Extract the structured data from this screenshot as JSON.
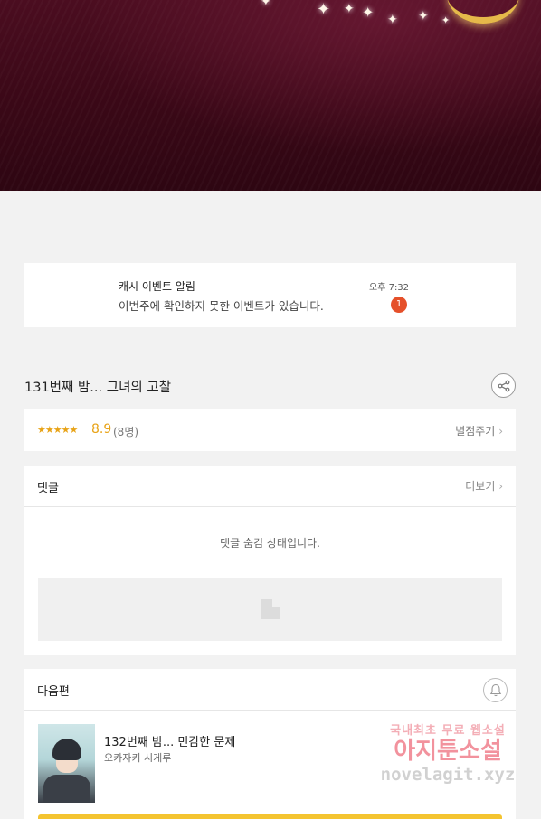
{
  "notification": {
    "title": "캐시 이벤트 알림",
    "message": "이번주에 확인하지 못한 이벤트가 있습니다.",
    "time": "오후 7:32",
    "badge_count": "1"
  },
  "episode": {
    "title": "131번째 밤... 그녀의 고찰",
    "share_icon": "share-icon"
  },
  "rating": {
    "stars": "★★★★★",
    "score": "8.9",
    "count": "(8명)",
    "rate_link": "별점주기",
    "accent_color": "#e8a317"
  },
  "comments": {
    "header": "댓글",
    "more_link": "더보기",
    "hidden_message": "댓글 숨김 상태입니다."
  },
  "next_episode": {
    "header": "다음편",
    "bell_icon": "bell-icon",
    "title": "132번째 밤... 민감한 문제",
    "author": "오카자키 시게루"
  },
  "watermark": {
    "line1": "국내최초 무료 웹소설",
    "line2": "아지툰소설",
    "line3": "novelagit.xyz"
  }
}
